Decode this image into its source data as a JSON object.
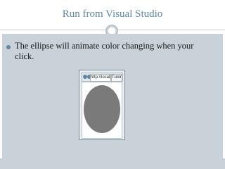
{
  "slide": {
    "title": "Run from Visual Studio",
    "bullet": "The ellipse will animate color changing when your click."
  },
  "browser": {
    "url": "http://localhost...",
    "tab_title": "TutorialAnimation",
    "shape": "ellipse",
    "shape_color": "#7a7a7a"
  },
  "colors": {
    "title": "#5a8aa8",
    "content_bg": "#c8d2d8"
  }
}
